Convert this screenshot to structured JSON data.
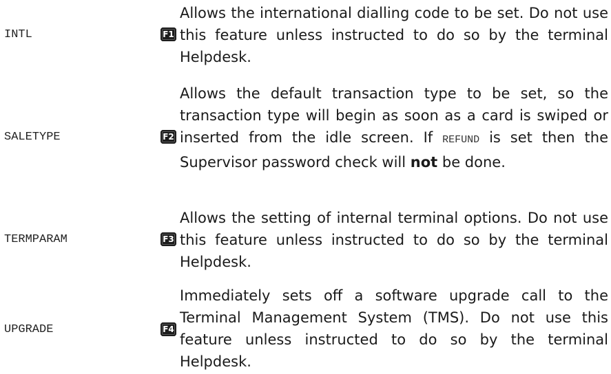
{
  "rows": [
    {
      "term": "INTL",
      "key": "F1",
      "description": "Allows the international dialling code to be set. Do not use this feature unless instructed to do so by the terminal Helpdesk."
    },
    {
      "term": "SALETYPE",
      "key": "F2",
      "description_parts": {
        "before": "Allows the default transaction type to be set, so the transaction type will begin as soon as a card is swiped or inserted from the idle screen. If ",
        "code": "REFUND",
        "middle": " is set then the Supervisor password check will ",
        "emphasis": "not",
        "after": " be done."
      }
    },
    {
      "term": "TERMPARAM",
      "key": "F3",
      "description": "Allows the setting of internal terminal options. Do not use this feature unless instructed to do so by the terminal Helpdesk."
    },
    {
      "term": "UPGRADE",
      "key": "F4",
      "description": "Immediately sets off a software upgrade call to the Terminal Management System (TMS). Do not use this feature unless instructed to do so by the terminal Helpdesk."
    }
  ]
}
